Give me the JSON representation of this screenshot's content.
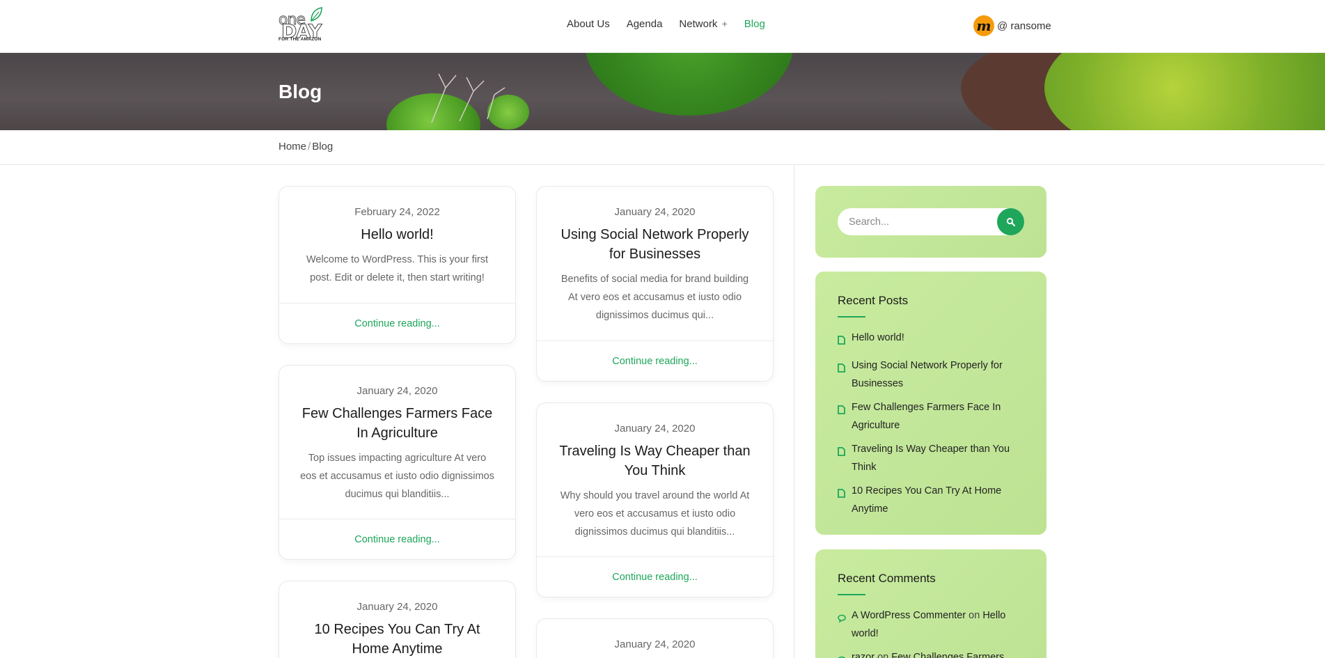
{
  "logo": {
    "line1": "one",
    "line2": "DAY",
    "tagline": "FOR THE AMAZON"
  },
  "nav": {
    "items": [
      {
        "label": "About Us"
      },
      {
        "label": "Agenda"
      },
      {
        "label": "Network",
        "suffix": "+"
      },
      {
        "label": "Blog",
        "active": true
      }
    ]
  },
  "user": {
    "avatar_letter": "m",
    "handle": "@ ransome"
  },
  "banner": {
    "title": "Blog"
  },
  "breadcrumb": {
    "home": "Home",
    "separator": "/",
    "current": "Blog"
  },
  "posts": [
    {
      "date": "February 24, 2022",
      "title": "Hello world!",
      "excerpt": "Welcome to WordPress. This is your first post. Edit or delete it, then start writing!",
      "more": "Continue reading..."
    },
    {
      "date": "January 24, 2020",
      "title": "Using Social Network Properly for Businesses",
      "excerpt": "Benefits of social media for brand building At vero eos et accusamus et iusto odio dignissimos ducimus qui...",
      "more": "Continue reading..."
    },
    {
      "date": "January 24, 2020",
      "title": "Few Challenges Farmers Face In Agriculture",
      "excerpt": "Top issues impacting agriculture At vero eos et accusamus et iusto odio dignissimos ducimus qui blanditiis...",
      "more": "Continue reading..."
    },
    {
      "date": "January 24, 2020",
      "title": "Traveling Is Way Cheaper than You Think",
      "excerpt": "Why should you travel around the world At vero eos et accusamus et iusto odio dignissimos ducimus qui blanditiis...",
      "more": "Continue reading..."
    },
    {
      "date": "January 24, 2020",
      "title": "10 Recipes You Can Try At Home Anytime"
    },
    {
      "date": "January 24, 2020"
    }
  ],
  "sidebar": {
    "search": {
      "placeholder": "Search..."
    },
    "recent_posts": {
      "title": "Recent Posts",
      "items": [
        "Hello world!",
        "Using Social Network Properly for Businesses",
        "Few Challenges Farmers Face In Agriculture",
        "Traveling Is Way Cheaper than You Think",
        "10 Recipes You Can Try At Home Anytime"
      ]
    },
    "recent_comments": {
      "title": "Recent Comments",
      "items": [
        {
          "author": "A WordPress Commenter",
          "on": "on",
          "post": "Hello world!"
        },
        {
          "author": "razor",
          "on": "on",
          "post": "Few Challenges Farmers Face"
        }
      ]
    }
  },
  "colors": {
    "accent": "#1ea65a",
    "widget_bg": "#c5e99c",
    "avatar": "#f59b0b"
  }
}
